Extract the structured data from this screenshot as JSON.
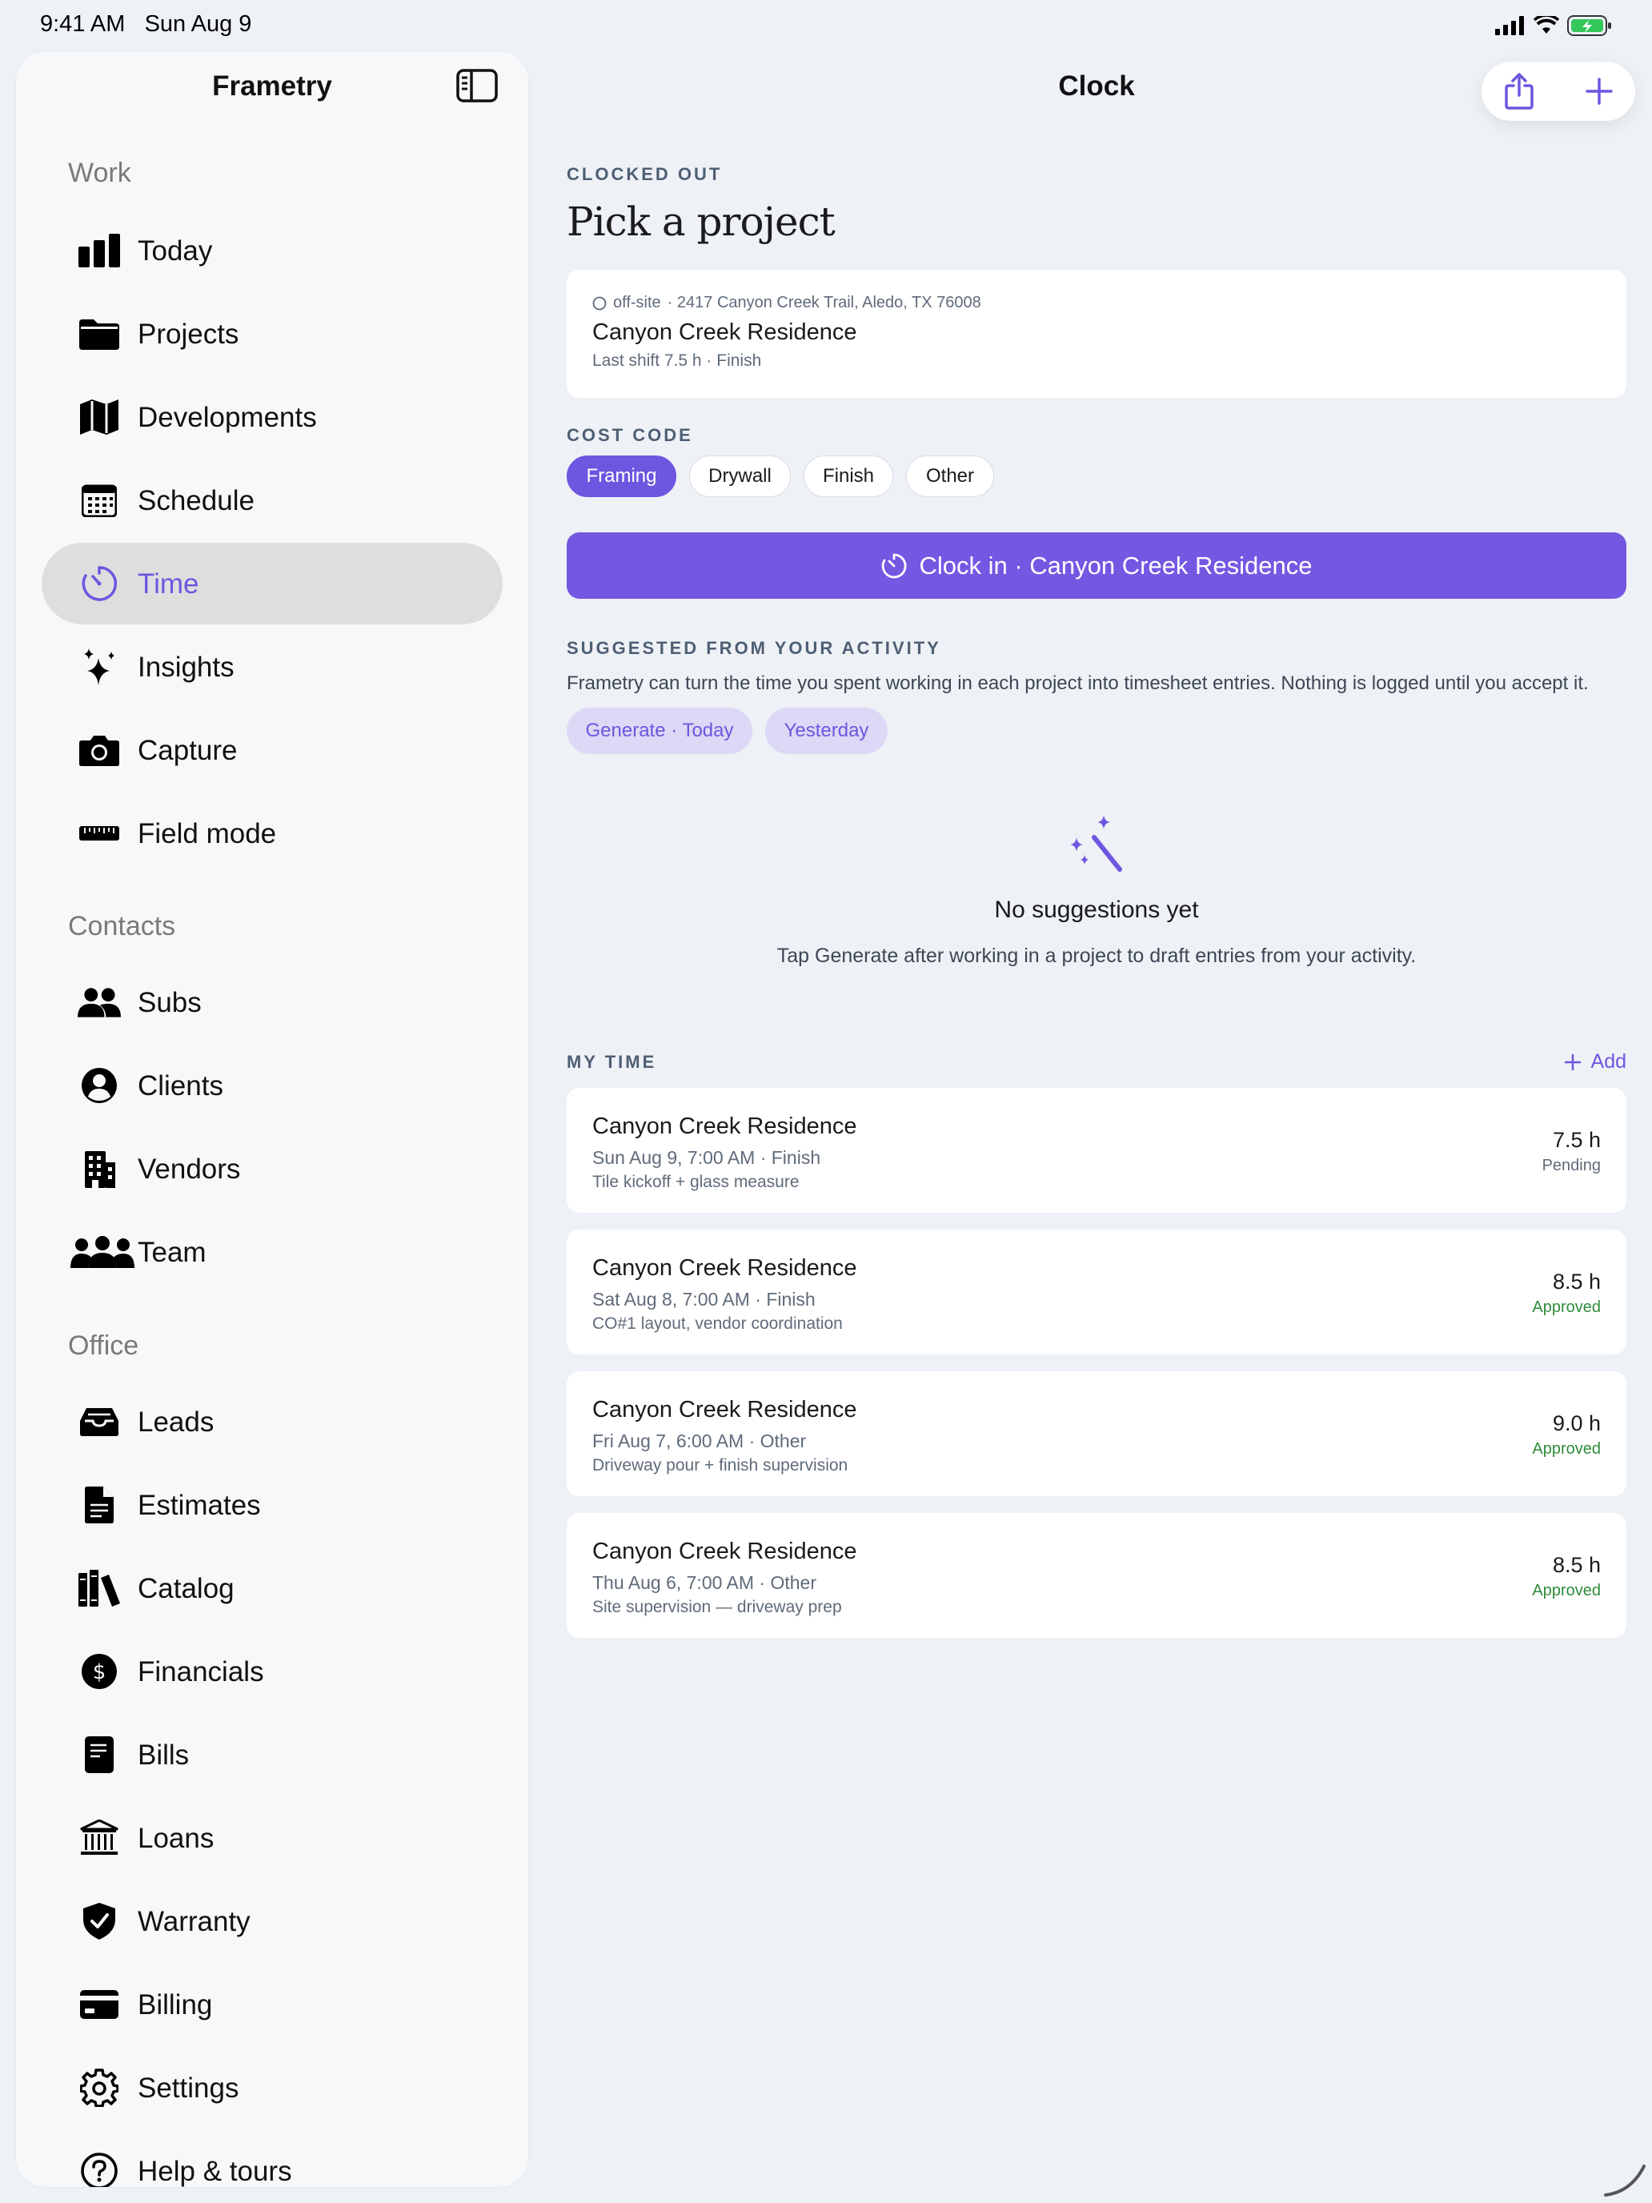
{
  "status_bar": {
    "time": "9:41 AM",
    "date": "Sun Aug 9"
  },
  "sidebar": {
    "title": "Frametry",
    "sections": {
      "work": "Work",
      "contacts": "Contacts",
      "office": "Office"
    },
    "items": [
      {
        "label": "Today",
        "icon": "bar-chart-icon"
      },
      {
        "label": "Projects",
        "icon": "folder-icon"
      },
      {
        "label": "Developments",
        "icon": "map-icon"
      },
      {
        "label": "Schedule",
        "icon": "calendar-icon"
      },
      {
        "label": "Time",
        "icon": "timer-icon",
        "active": true
      },
      {
        "label": "Insights",
        "icon": "sparkles-icon"
      },
      {
        "label": "Capture",
        "icon": "camera-icon"
      },
      {
        "label": "Field mode",
        "icon": "ruler-icon"
      },
      {
        "label": "Subs",
        "icon": "people-icon"
      },
      {
        "label": "Clients",
        "icon": "person-circle-icon"
      },
      {
        "label": "Vendors",
        "icon": "building-icon"
      },
      {
        "label": "Team",
        "icon": "group-icon"
      },
      {
        "label": "Leads",
        "icon": "tray-icon"
      },
      {
        "label": "Estimates",
        "icon": "document-icon"
      },
      {
        "label": "Catalog",
        "icon": "books-icon"
      },
      {
        "label": "Financials",
        "icon": "dollar-circle-icon"
      },
      {
        "label": "Bills",
        "icon": "bill-icon"
      },
      {
        "label": "Loans",
        "icon": "bank-icon"
      },
      {
        "label": "Warranty",
        "icon": "shield-check-icon"
      },
      {
        "label": "Billing",
        "icon": "credit-card-icon"
      },
      {
        "label": "Settings",
        "icon": "gear-icon"
      },
      {
        "label": "Help & tours",
        "icon": "help-circle-icon"
      }
    ]
  },
  "main": {
    "title": "Clock",
    "clock_status": "CLOCKED OUT",
    "headline": "Pick a project",
    "project": {
      "meta_site": "off-site",
      "meta_address": "· 2417 Canyon Creek Trail, Aledo, TX 76008",
      "name": "Canyon Creek Residence",
      "last_shift": "Last shift 7.5 h · Finish"
    },
    "cost_code": {
      "label": "COST CODE",
      "options": [
        "Framing",
        "Drywall",
        "Finish",
        "Other"
      ],
      "selected": "Framing"
    },
    "clock_in_label": "Clock in · Canyon Creek Residence",
    "suggestions": {
      "label": "SUGGESTED FROM YOUR ACTIVITY",
      "description": "Frametry can turn the time you spent working in each project into timesheet entries. Nothing is logged until you accept it.",
      "generate_today": "Generate · Today",
      "yesterday": "Yesterday",
      "empty_title": "No suggestions yet",
      "empty_description": "Tap Generate after working in a project to draft entries from your activity."
    },
    "my_time": {
      "label": "MY TIME",
      "add_label": "Add",
      "entries": [
        {
          "project": "Canyon Creek Residence",
          "date": "Sun Aug 9, 7:00 AM · Finish",
          "note": "Tile kickoff + glass measure",
          "hours": "7.5 h",
          "status": "Pending"
        },
        {
          "project": "Canyon Creek Residence",
          "date": "Sat Aug 8, 7:00 AM · Finish",
          "note": "CO#1 layout, vendor coordination",
          "hours": "8.5 h",
          "status": "Approved"
        },
        {
          "project": "Canyon Creek Residence",
          "date": "Fri Aug 7, 6:00 AM · Other",
          "note": "Driveway pour + finish supervision",
          "hours": "9.0 h",
          "status": "Approved"
        },
        {
          "project": "Canyon Creek Residence",
          "date": "Thu Aug 6, 7:00 AM · Other",
          "note": "Site supervision — driveway prep",
          "hours": "8.5 h",
          "status": "Approved"
        }
      ]
    }
  },
  "colors": {
    "accent": "#6e56e0",
    "approved": "#2e8b3a",
    "pending": "#5f6b7a",
    "background": "#eef1f6"
  }
}
